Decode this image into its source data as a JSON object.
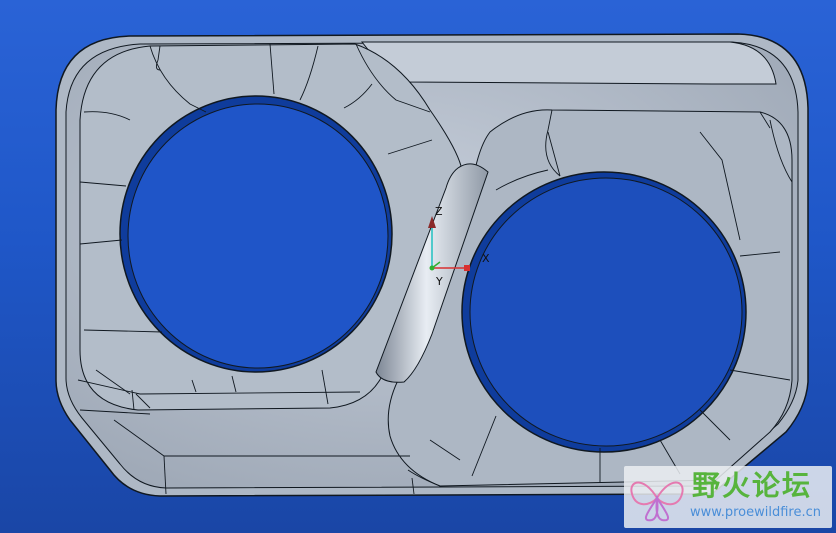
{
  "csys": {
    "z_label": "Z",
    "x_label": "X",
    "y_label": "Y"
  },
  "watermark": {
    "title": "野火论坛",
    "url": "www.proewildfire.cn",
    "logo_icon": "butterfly-logo-icon"
  },
  "colors": {
    "background": "#2a63d6",
    "part_surface": "#b9c3ce",
    "edge": "#101820",
    "axis_x": "#d83030",
    "axis_z": "#20c0c0",
    "watermark_green": "#57b43d",
    "watermark_blue": "#4a8ed8"
  }
}
